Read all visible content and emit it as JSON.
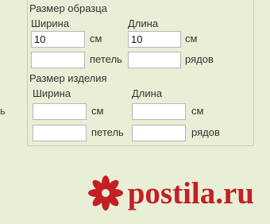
{
  "side_mark": "ь",
  "sample": {
    "title": "Размер образца",
    "width_label": "Ширина",
    "length_label": "Длина",
    "width_cm_value": "10",
    "length_cm_value": "10",
    "stitches_value": "",
    "rows_value": "",
    "unit_cm": "см",
    "unit_stitches": "петель",
    "unit_rows": "рядов"
  },
  "product": {
    "title": "Размер изделия",
    "width_label": "Ширина",
    "length_label": "Длина",
    "width_cm_value": "",
    "length_cm_value": "",
    "stitches_value": "",
    "rows_value": "",
    "unit_cm": "см",
    "unit_stitches": "петель",
    "unit_rows": "рядов"
  },
  "watermark": {
    "text": "postila.ru",
    "color": "#c32026",
    "icon": "flower-logo-icon"
  }
}
